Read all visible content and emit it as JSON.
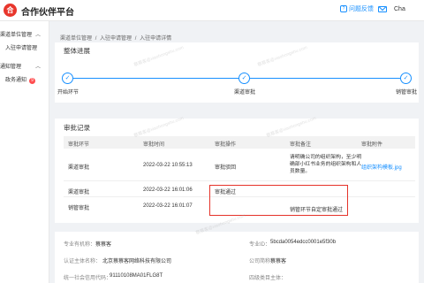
{
  "app": {
    "logo_text": "合",
    "title": "合作伙伴平台",
    "feedback_label": "问题反馈",
    "user_name": "Cha"
  },
  "sidebar": {
    "groups": [
      {
        "label": "渠道单位管理",
        "chevron": "︿",
        "items": [
          {
            "label": "入驻申请管理"
          }
        ]
      },
      {
        "label": "通知管理",
        "chevron": "︿",
        "items": [
          {
            "label": "政务通知",
            "badge": "9"
          }
        ]
      }
    ]
  },
  "breadcrumb": [
    "渠道单位管理",
    "/",
    "入驻申请管理",
    "/",
    "入驻申请详情"
  ],
  "progress": {
    "title": "整体进展",
    "steps": [
      {
        "label": "开始环节",
        "check": "✓"
      },
      {
        "label": "渠道审批",
        "check": "✓"
      },
      {
        "label": "销管审批",
        "check": "✓"
      }
    ]
  },
  "records": {
    "title": "审批记录",
    "columns": [
      "审批环节",
      "审批时间",
      "审批操作",
      "审批备注",
      "审批附件"
    ],
    "rows": [
      {
        "stage": "渠道审批",
        "time": "2022-03-22 10:55:13",
        "action": "审批驳回",
        "comment": "请明确公司的组织架构，至少明确部小红书业务的组织架构和人员数量。",
        "attachment": "组织架构模板.jpg"
      },
      {
        "stage": "渠道审批",
        "time": "2022-03-22 16:01:06",
        "action": "审批通过",
        "comment": "",
        "attachment": ""
      },
      {
        "stage": "销管审批",
        "time": "2022-03-22 16:01:07",
        "action": "",
        "comment": "销管环节自定审批通过",
        "attachment": ""
      }
    ]
  },
  "info": {
    "fields": [
      {
        "label": "专业有机称：",
        "value": "蔡蔡客"
      },
      {
        "label": "专业ID：",
        "value": "5bcda0054edcc0001e5f30b"
      },
      {
        "label": "认证主体名称：",
        "value": "北京蔡蔡客网络科技有限公司"
      },
      {
        "label": "公司简称：",
        "value": "蔡蔡客"
      },
      {
        "label": "统一社会信用代码：",
        "value": "91110108MA01FLG8T"
      },
      {
        "label": "四级类目主体：",
        "value": ""
      }
    ]
  },
  "watermark": "蔡蔡客@xiaohongshu.com"
}
